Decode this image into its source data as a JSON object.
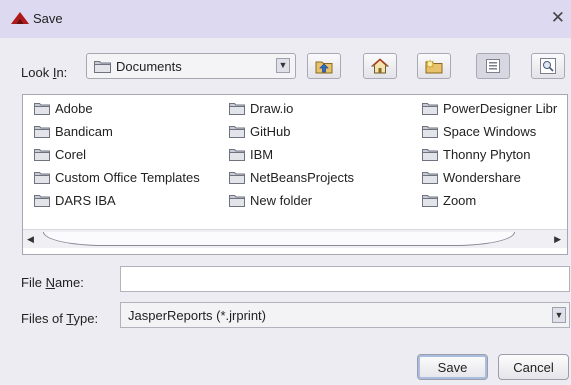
{
  "window": {
    "title": "Save",
    "close": "✕",
    "icon": "app-logo-icon"
  },
  "look_in": {
    "label_prefix": "Look ",
    "label_mnemonic": "I",
    "label_suffix": "n:",
    "selected": "Documents",
    "arrow": "▼"
  },
  "toolbar": {
    "buttons": [
      "up-one-level-icon",
      "home-icon",
      "new-folder-icon",
      "list-view-icon",
      "details-view-icon"
    ]
  },
  "files": {
    "columns": [
      [
        "Adobe",
        "Bandicam",
        "Corel",
        "Custom Office Templates",
        "DARS IBA"
      ],
      [
        "Draw.io",
        "GitHub",
        "IBM",
        "NetBeansProjects",
        "New folder"
      ],
      [
        "PowerDesigner Libr",
        "Space Windows",
        "Thonny Phyton",
        "Wondershare",
        "Zoom"
      ]
    ],
    "scroll_left": "◀",
    "scroll_right": "▶"
  },
  "file_name": {
    "label_prefix": "File ",
    "label_mnemonic": "N",
    "label_suffix": "ame:",
    "value": ""
  },
  "file_type": {
    "label_prefix": "Files of ",
    "label_mnemonic": "T",
    "label_suffix": "ype:",
    "selected": "JasperReports (*.jrprint)",
    "arrow": "▼"
  },
  "buttons": {
    "save": "Save",
    "cancel": "Cancel"
  }
}
